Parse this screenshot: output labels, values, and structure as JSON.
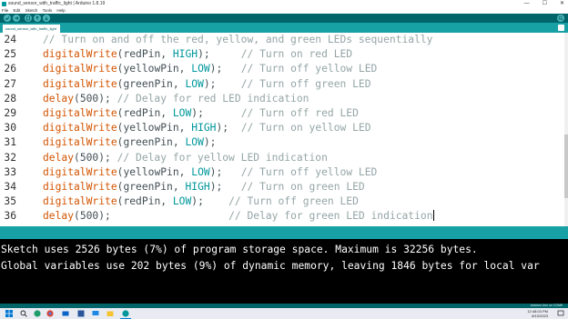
{
  "window": {
    "title": "sound_sensor_with_traffic_light | Arduino 1.8.19",
    "controls": [
      "—",
      "☐",
      "✕"
    ]
  },
  "menu": [
    "File",
    "Edit",
    "Sketch",
    "Tools",
    "Help"
  ],
  "tab": {
    "label": "sound_sensor_with_traffic_light"
  },
  "editor": {
    "lines": [
      {
        "num": "24",
        "code": "// Turn on and off the red, yellow, and green LEDs sequentially"
      },
      {
        "num": "25",
        "code": "digitalWrite(redPin, HIGH);     // Turn on red LED"
      },
      {
        "num": "26",
        "code": "digitalWrite(yellowPin, LOW);   // Turn off yellow LED"
      },
      {
        "num": "27",
        "code": "digitalWrite(greenPin, LOW);    // Turn off green LED"
      },
      {
        "num": "28",
        "code": "delay(500); // Delay for red LED indication"
      },
      {
        "num": "29",
        "code": "digitalWrite(redPin, LOW);      // Turn off red LED"
      },
      {
        "num": "30",
        "code": "digitalWrite(yellowPin, HIGH);  // Turn on yellow LED"
      },
      {
        "num": "31",
        "code": "digitalWrite(greenPin, LOW);"
      },
      {
        "num": "32",
        "code": "delay(500); // Delay for yellow LED indication"
      },
      {
        "num": "33",
        "code": "digitalWrite(yellowPin, LOW);   // Turn off yellow LED"
      },
      {
        "num": "34",
        "code": "digitalWrite(greenPin, HIGH);   // Turn on green LED"
      },
      {
        "num": "35",
        "code": "digitalWrite(redPin, LOW);    // Turn off green LED"
      },
      {
        "num": "36",
        "code": "delay(500);                   // Delay for green LED indication"
      }
    ]
  },
  "console": {
    "lines": [
      "Sketch uses 2526 bytes (7%) of program storage space. Maximum is 32256 bytes.",
      "Global variables use 202 bytes (9%) of dynamic memory, leaving 1846 bytes for local var"
    ]
  },
  "footer": {
    "board": "Arduino Uno on COM6"
  },
  "taskbar": {
    "time": "12:48:03 PM",
    "date": "8/10/2023"
  },
  "colors": {
    "toolbar": "#006468",
    "tabbar": "#17a1a5",
    "function": "#d35400",
    "constant": "#00979c",
    "comment": "#95a5a6",
    "text": "#434f54"
  }
}
